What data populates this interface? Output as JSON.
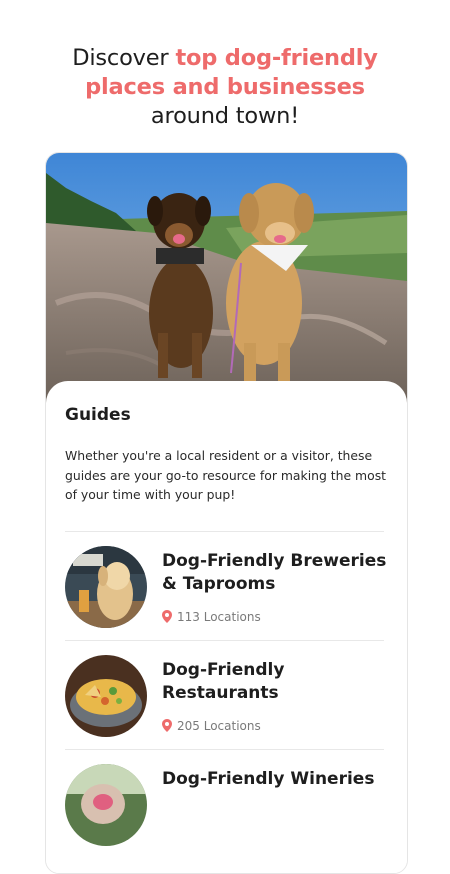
{
  "headline": {
    "prefix": "Discover ",
    "accent_line1": "top dog-friendly",
    "accent_line2": "places and businesses",
    "suffix": "around town!"
  },
  "colors": {
    "accent": "#ee6b6b",
    "text": "#1e1e1e",
    "muted": "#7a7a7a"
  },
  "guides": {
    "title": "Guides",
    "description": "Whether you're a local resident or a visitor, these guides are your go-to resource for making the most of your time with your pup!",
    "items": [
      {
        "title": "Dog-Friendly Breweries & Taprooms",
        "count": "113 Locations",
        "icon": "location-pin-icon"
      },
      {
        "title": "Dog-Friendly Restaurants",
        "count": "205 Locations",
        "icon": "location-pin-icon"
      },
      {
        "title": "Dog-Friendly Wineries",
        "count": "",
        "icon": "location-pin-icon"
      }
    ]
  }
}
